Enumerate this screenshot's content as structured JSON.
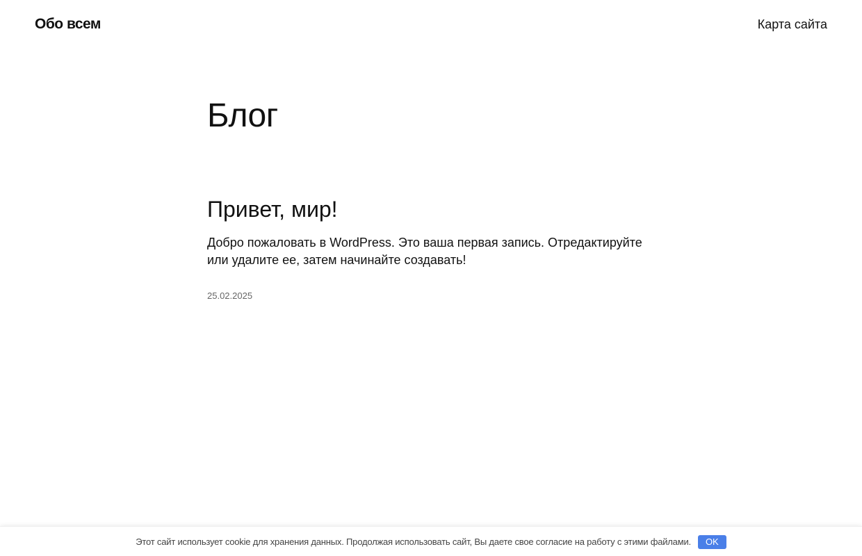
{
  "header": {
    "site_title": "Обо всем",
    "nav": [
      {
        "label": "Карта сайта"
      }
    ]
  },
  "main": {
    "page_title": "Блог",
    "posts": [
      {
        "title": "Привет, мир!",
        "excerpt": "Добро пожаловать в WordPress. Это ваша первая запись. Отредактируйте или удалите ее, затем начинайте создавать!",
        "date": "25.02.2025"
      }
    ]
  },
  "cookie_notice": {
    "text": "Этот сайт использует cookie для хранения данных. Продолжая использовать сайт, Вы даете свое согласие на работу с этими файлами.",
    "button_label": "OK",
    "button_color": "#4a7fe8"
  }
}
